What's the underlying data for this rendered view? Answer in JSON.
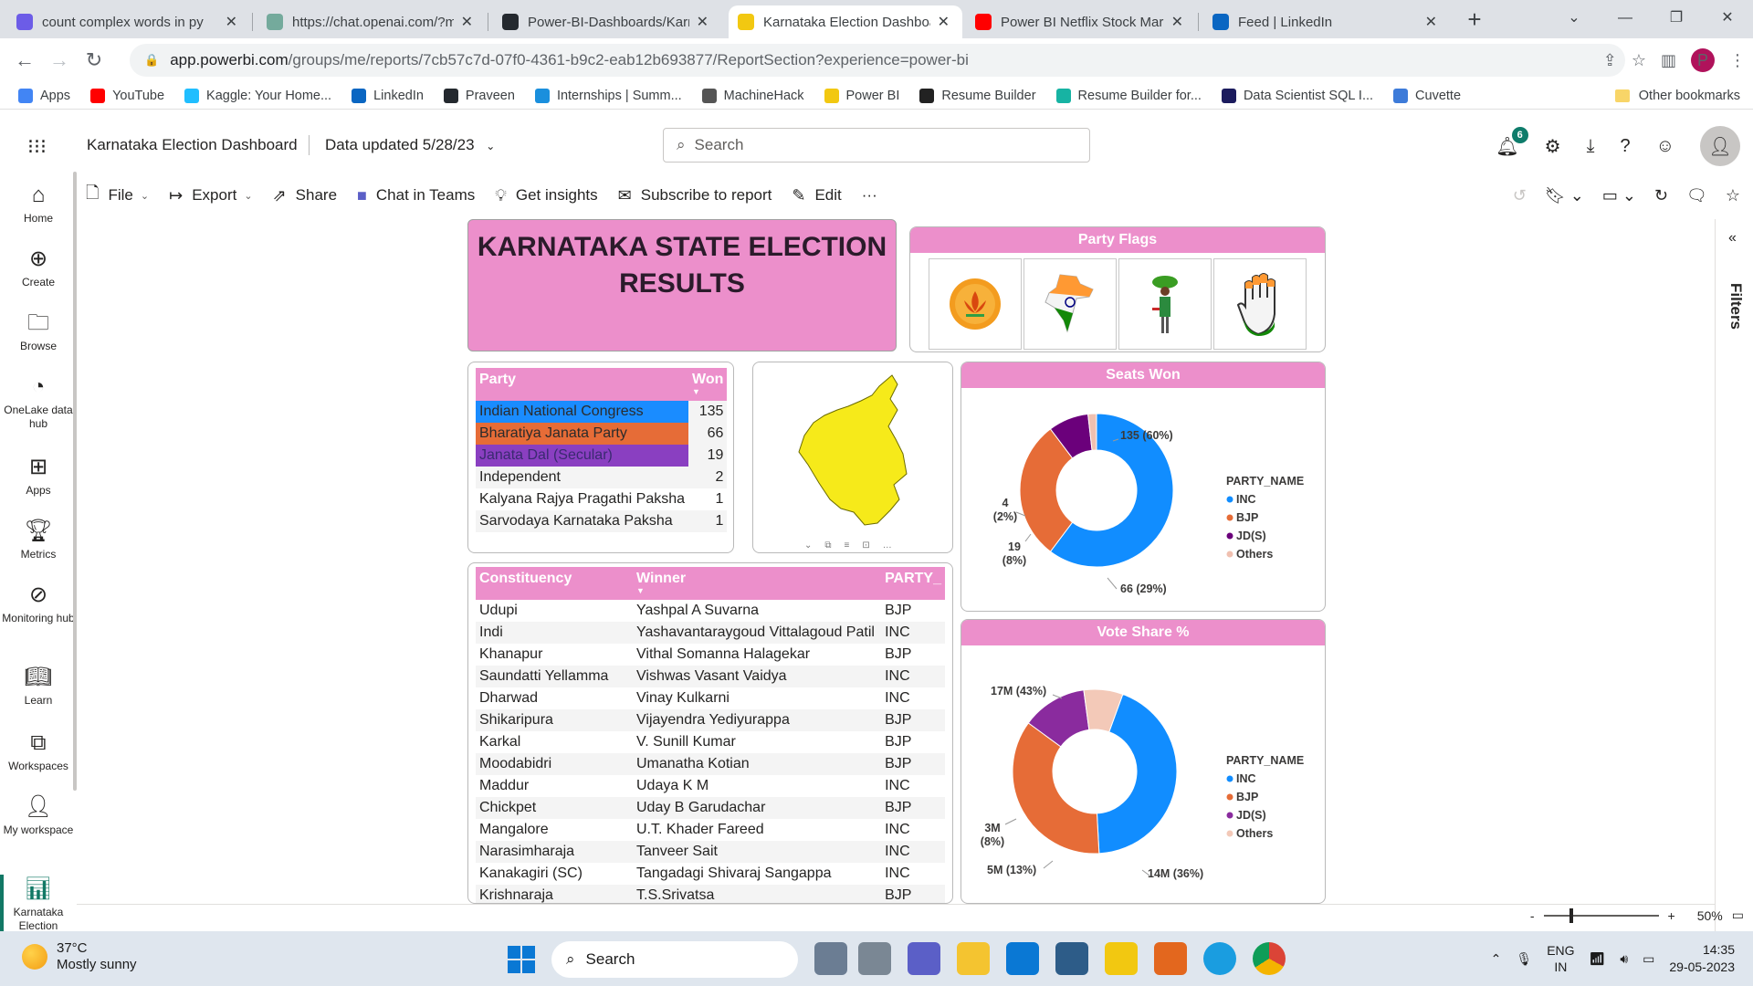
{
  "browser": {
    "tabs": [
      {
        "title": "count complex words in py",
        "color": "#6c5ce7",
        "icon": "app-icon"
      },
      {
        "title": "https://chat.openai.com/?m",
        "color": "#74aa9c",
        "icon": "openai-icon"
      },
      {
        "title": "Power-BI-Dashboards/Karn",
        "color": "#24292f",
        "icon": "github-icon"
      },
      {
        "title": "Karnataka Election Dashboa",
        "color": "#f2c811",
        "icon": "powerbi-icon",
        "active": true
      },
      {
        "title": "Power BI Netflix Stock Mark",
        "color": "#ff0000",
        "icon": "youtube-icon"
      },
      {
        "title": "Feed | LinkedIn",
        "color": "#0a66c2",
        "icon": "linkedin-icon"
      }
    ],
    "url_domain": "app.powerbi.com",
    "url_path": "/groups/me/reports/7cb57c7d-07f0-4361-b9c2-eab12b693877/ReportSection?experience=power-bi",
    "profile_initial": "P",
    "bookmarks": [
      {
        "label": "Apps",
        "color": "#4285f4"
      },
      {
        "label": "YouTube",
        "color": "#ff0000"
      },
      {
        "label": "Kaggle: Your Home...",
        "color": "#20beff"
      },
      {
        "label": "LinkedIn",
        "color": "#0a66c2"
      },
      {
        "label": "Praveen",
        "color": "#24292f"
      },
      {
        "label": "Internships | Summ...",
        "color": "#1a8fdd"
      },
      {
        "label": "MachineHack",
        "color": "#555555"
      },
      {
        "label": "Power BI",
        "color": "#f2c811"
      },
      {
        "label": "Resume Builder",
        "color": "#222222"
      },
      {
        "label": "Resume Builder for...",
        "color": "#17b3a3"
      },
      {
        "label": "Data Scientist SQL I...",
        "color": "#1c1c5e"
      },
      {
        "label": "Cuvette",
        "color": "#3d7bd9"
      }
    ],
    "other_bookmarks": "Other bookmarks"
  },
  "pbi_header": {
    "report_title": "Karnataka Election Dashboard",
    "data_updated": "Data updated 5/28/23",
    "search_placeholder": "Search",
    "notification_count": "6"
  },
  "left_nav": [
    {
      "label": "Home",
      "icon": "home-icon"
    },
    {
      "label": "Create",
      "icon": "plus-circle-icon"
    },
    {
      "label": "Browse",
      "icon": "folder-icon"
    },
    {
      "label": "OneLake data hub",
      "icon": "onelake-icon"
    },
    {
      "label": "Apps",
      "icon": "apps-icon"
    },
    {
      "label": "Metrics",
      "icon": "trophy-icon"
    },
    {
      "label": "Monitoring hub",
      "icon": "monitoring-icon"
    },
    {
      "label": "Learn",
      "icon": "book-icon"
    },
    {
      "label": "Workspaces",
      "icon": "workspaces-icon"
    },
    {
      "label": "My workspace",
      "icon": "person-icon"
    },
    {
      "label": "Karnataka Election",
      "icon": "report-icon"
    }
  ],
  "toolbar": {
    "file": "File",
    "export": "Export",
    "share": "Share",
    "chat_teams": "Chat in Teams",
    "insights": "Get insights",
    "subscribe": "Subscribe to report",
    "edit": "Edit",
    "more": "···"
  },
  "filters_label": "Filters",
  "zoom": "50%",
  "report": {
    "title": "KARNATAKA STATE ELECTION RESULTS",
    "flags_title": "Party Flags",
    "party_table": {
      "headers": [
        "Party",
        "Won"
      ],
      "rows": [
        {
          "party": "Indian National Congress",
          "won": "135",
          "color": "#1a8cff"
        },
        {
          "party": "Bharatiya Janata Party",
          "won": "66",
          "color": "#e66c37"
        },
        {
          "party": "Janata Dal (Secular)",
          "won": "19",
          "color": "#8a3fc1"
        },
        {
          "party": "Independent",
          "won": "2",
          "color": "#f4f4f4"
        },
        {
          "party": "Kalyana Rajya Pragathi Paksha",
          "won": "1",
          "color": "#ffffff"
        },
        {
          "party": "Sarvodaya Karnataka Paksha",
          "won": "1",
          "color": "#f4f4f4"
        }
      ]
    },
    "constituency_table": {
      "headers": [
        "Constituency",
        "Winner",
        "PARTY_"
      ],
      "rows": [
        [
          "Udupi",
          "Yashpal A Suvarna",
          "BJP"
        ],
        [
          "Indi",
          "Yashavantaraygoud Vittalagoud Patil",
          "INC"
        ],
        [
          "Khanapur",
          "Vithal Somanna Halagekar",
          "BJP"
        ],
        [
          "Saundatti Yellamma",
          "Vishwas Vasant Vaidya",
          "INC"
        ],
        [
          "Dharwad",
          "Vinay Kulkarni",
          "INC"
        ],
        [
          "Shikaripura",
          "Vijayendra Yediyurappa",
          "BJP"
        ],
        [
          "Karkal",
          "V. Sunill Kumar",
          "BJP"
        ],
        [
          "Moodabidri",
          "Umanatha Kotian",
          "BJP"
        ],
        [
          "Maddur",
          "Udaya K M",
          "INC"
        ],
        [
          "Chickpet",
          "Uday B Garudachar",
          "BJP"
        ],
        [
          "Mangalore",
          "U.T. Khader Fareed",
          "INC"
        ],
        [
          "Narasimharaja",
          "Tanveer Sait",
          "INC"
        ],
        [
          "Kanakagiri (SC)",
          "Tangadagi Shivaraj Sangappa",
          "INC"
        ],
        [
          "Krishnaraja",
          "T.S.Srivatsa",
          "BJP"
        ]
      ]
    },
    "legend_title": "PARTY_NAME",
    "legend": [
      {
        "name": "INC",
        "color": "#118dff"
      },
      {
        "name": "BJP",
        "color": "#e66c37"
      },
      {
        "name": "JD(S)",
        "color": "#6b007b"
      },
      {
        "name": "Others",
        "color": "#f0c0b0"
      }
    ]
  },
  "chart_data": [
    {
      "type": "pie",
      "title": "Seats Won",
      "categories": [
        "INC",
        "BJP",
        "JD(S)",
        "Others"
      ],
      "values": [
        135,
        66,
        19,
        4
      ],
      "labels": [
        "135 (60%)",
        "66 (29%)",
        "19 (8%)",
        "4 (2%)"
      ],
      "colors": [
        "#118dff",
        "#e66c37",
        "#6b007b",
        "#f0c0b0"
      ],
      "legend_position": "right"
    },
    {
      "type": "pie",
      "title": "Vote Share %",
      "categories": [
        "INC",
        "BJP",
        "JD(S)",
        "Others"
      ],
      "values": [
        17,
        14,
        5,
        3
      ],
      "labels": [
        "17M (43%)",
        "14M (36%)",
        "5M (13%)",
        "3M (8%)"
      ],
      "colors": [
        "#118dff",
        "#e66c37",
        "#8a2b9e",
        "#f3c9b8"
      ],
      "legend_position": "right"
    }
  ],
  "taskbar": {
    "temperature": "37°C",
    "weather": "Mostly sunny",
    "search": "Search",
    "lang": "ENG",
    "region": "IN",
    "time": "14:35",
    "date": "29-05-2023"
  }
}
